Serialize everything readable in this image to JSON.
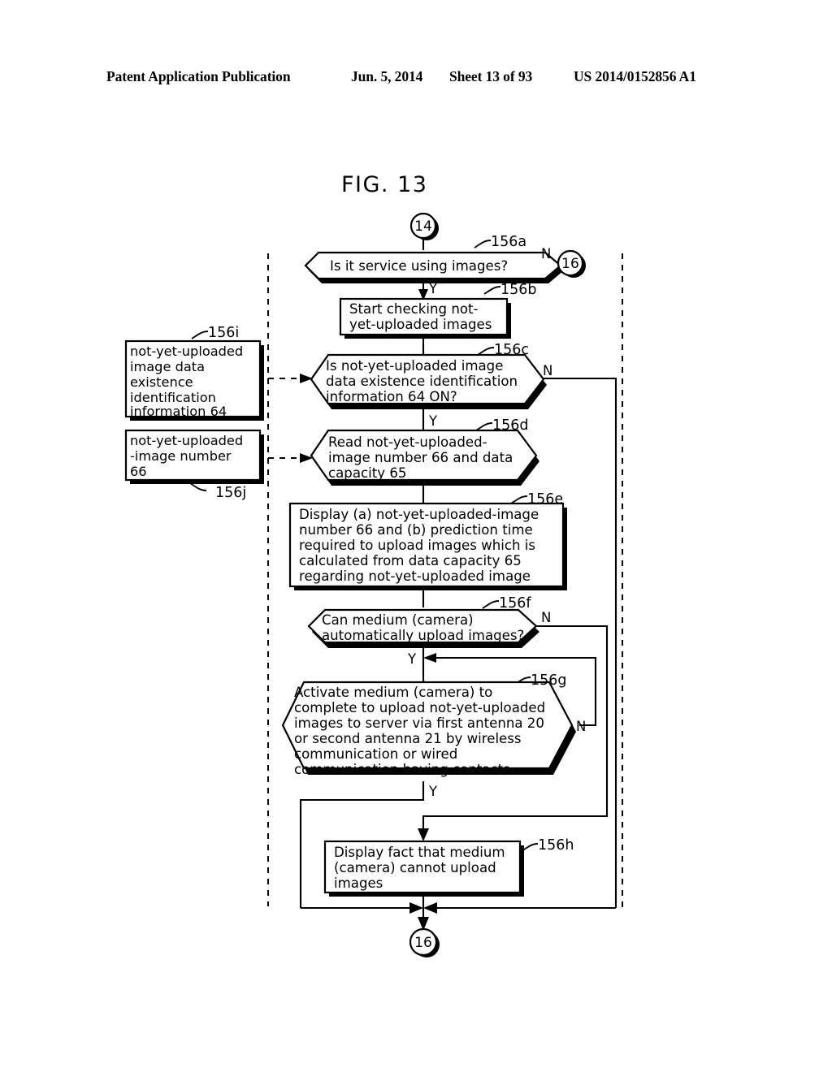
{
  "header": {
    "publication": "Patent Application Publication",
    "date": "Jun. 5, 2014",
    "sheet": "Sheet 13 of 93",
    "patent_number": "US 2014/0152856 A1"
  },
  "figure": {
    "title": "FIG. 13",
    "connectors": {
      "top": "14",
      "exit_right": "16",
      "bottom": "16"
    },
    "branch_labels": {
      "a_no": "N",
      "a_yes": "Y",
      "c_no": "N",
      "c_yes": "Y",
      "f_no": "N",
      "f_yes": "Y",
      "g_no": "N",
      "g_yes": "Y"
    },
    "nodes": [
      {
        "id": "156a",
        "ref": "156a",
        "shape": "decision",
        "text": "Is it service using images?"
      },
      {
        "id": "156b",
        "ref": "156b",
        "shape": "process",
        "lines": [
          "Start checking not-",
          "yet-uploaded images"
        ]
      },
      {
        "id": "156c",
        "ref": "156c",
        "shape": "decision",
        "lines": [
          "Is not-yet-uploaded image",
          "data existence identification",
          "information 64 ON?"
        ]
      },
      {
        "id": "156d",
        "ref": "156d",
        "shape": "decision",
        "lines": [
          "Read not-yet-uploaded-",
          "image number 66 and data",
          "capacity 65"
        ]
      },
      {
        "id": "156e",
        "ref": "156e",
        "shape": "process",
        "lines": [
          "Display (a) not-yet-uploaded-image",
          "number 66 and (b) prediction time",
          "required to upload images which is",
          "calculated from data capacity 65",
          "regarding not-yet-uploaded image"
        ]
      },
      {
        "id": "156f",
        "ref": "156f",
        "shape": "decision",
        "lines": [
          "Can medium (camera)",
          "automatically upload images?"
        ]
      },
      {
        "id": "156g",
        "ref": "156g",
        "shape": "decision",
        "lines": [
          "Activate medium (camera) to",
          "complete to upload not-yet-uploaded",
          "images to server via first antenna 20",
          "or second antenna 21 by wireless",
          "communication or wired",
          "communication having contacts"
        ]
      },
      {
        "id": "156h",
        "ref": "156h",
        "shape": "process",
        "lines": [
          "Display fact that medium",
          "(camera) cannot upload",
          "images"
        ]
      },
      {
        "id": "156i",
        "ref": "156i",
        "shape": "data-store",
        "lines": [
          "not-yet-uploaded",
          "image data",
          "existence",
          "identification",
          "information 64"
        ]
      },
      {
        "id": "156j",
        "ref": "156j",
        "shape": "data-store",
        "lines": [
          "not-yet-uploaded",
          "-image number",
          "66"
        ]
      }
    ]
  }
}
